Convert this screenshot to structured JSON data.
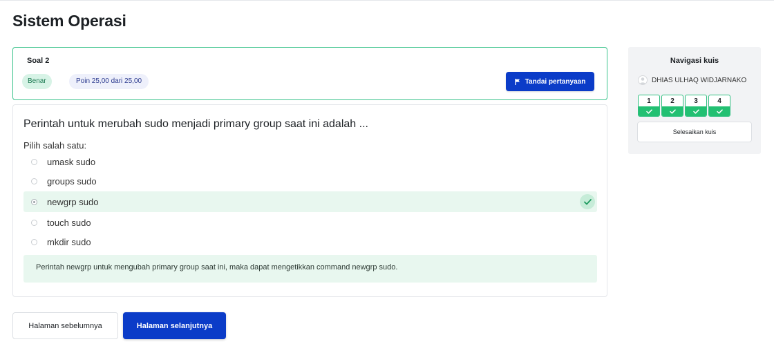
{
  "page": {
    "title": "Sistem Operasi"
  },
  "question_info": {
    "number_label": "Soal 2",
    "status_badge": "Benar",
    "points_badge": "Poin 25,00 dari 25,00",
    "flag_button": "Tandai pertanyaan",
    "flag_icon": "flag-icon"
  },
  "question": {
    "text": "Perintah untuk merubah sudo menjadi primary group saat ini adalah ...",
    "prompt": "Pilih salah satu:",
    "answers": [
      {
        "label": "umask sudo",
        "selected": false,
        "correct": false
      },
      {
        "label": "groups sudo",
        "selected": false,
        "correct": false
      },
      {
        "label": "newgrp sudo",
        "selected": true,
        "correct": true
      },
      {
        "label": "touch sudo",
        "selected": false,
        "correct": false
      },
      {
        "label": "mkdir sudo",
        "selected": false,
        "correct": false
      }
    ],
    "feedback": "Perintah newgrp untuk mengubah primary group saat ini, maka dapat mengetikkan command newgrp sudo."
  },
  "buttons": {
    "prev": "Halaman sebelumnya",
    "next": "Halaman selanjutnya"
  },
  "navigation": {
    "title": "Navigasi kuis",
    "user_name": "DHIAS ULHAQ WIDJARNAKO",
    "questions": [
      "1",
      "2",
      "3",
      "4"
    ],
    "finish_button": "Selesaikan kuis"
  },
  "colors": {
    "primary": "#0b3cc8",
    "correct_green": "#22c072",
    "correct_bg": "#e8f7ef",
    "border_green": "#38c28a"
  }
}
